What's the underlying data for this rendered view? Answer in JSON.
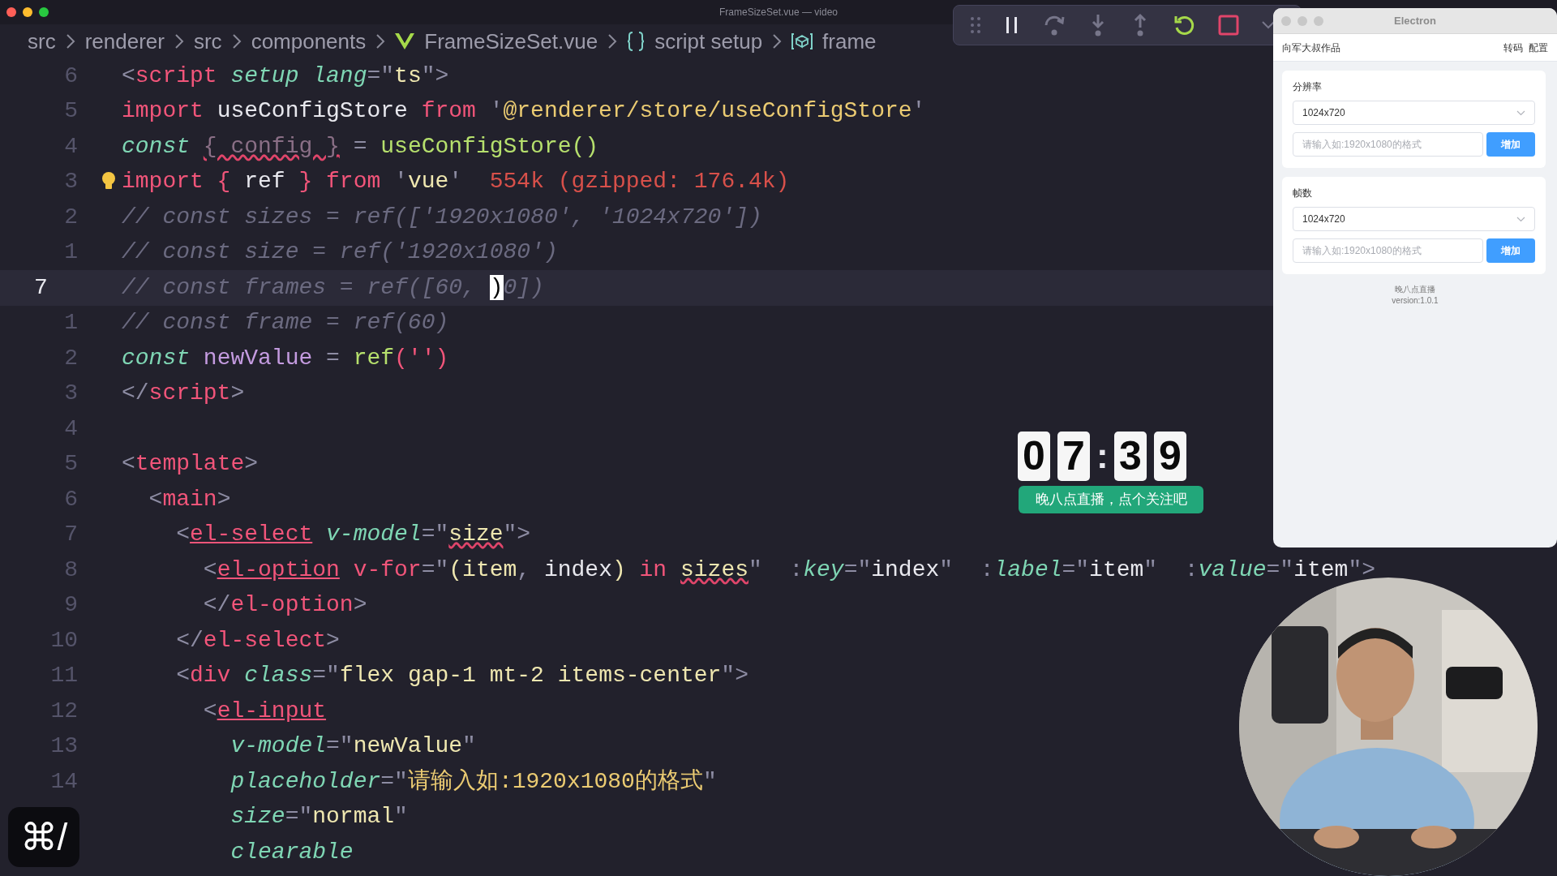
{
  "window": {
    "title": "FrameSizeSet.vue — video"
  },
  "breadcrumb": [
    {
      "kind": "folder",
      "text": "src"
    },
    {
      "kind": "folder",
      "text": "renderer"
    },
    {
      "kind": "folder",
      "text": "src"
    },
    {
      "kind": "folder",
      "text": "components"
    },
    {
      "kind": "vue-file",
      "text": "FrameSizeSet.vue"
    },
    {
      "kind": "braces",
      "text": "script setup"
    },
    {
      "kind": "symbol",
      "text": "frame"
    }
  ],
  "editor": {
    "lines": [
      {
        "number": "6",
        "selected": false,
        "lightbulb": false,
        "tokens": [
          {
            "kind": "punct",
            "text": "<"
          },
          {
            "kind": "tag",
            "text": "script"
          },
          {
            "kind": "attr",
            "text": " setup lang"
          },
          {
            "kind": "punct",
            "text": "=\""
          },
          {
            "kind": "string",
            "text": "ts"
          },
          {
            "kind": "punct",
            "text": "\">"
          }
        ]
      },
      {
        "number": "5",
        "selected": false,
        "lightbulb": false,
        "tokens": [
          {
            "kind": "keyword",
            "text": "import"
          },
          {
            "kind": "plain",
            "text": " useConfigStore "
          },
          {
            "kind": "keyword",
            "text": "from"
          },
          {
            "kind": "punct",
            "text": " '"
          },
          {
            "kind": "path",
            "text": "@renderer/store/useConfigStore"
          },
          {
            "kind": "punct",
            "text": "'"
          }
        ]
      },
      {
        "number": "4",
        "selected": false,
        "lightbulb": false,
        "tokens": [
          {
            "kind": "storage",
            "text": "const "
          },
          {
            "kind": "unused-error",
            "text": "{ config }"
          },
          {
            "kind": "punct",
            "text": " = "
          },
          {
            "kind": "fn",
            "text": "useConfigStore()"
          }
        ]
      },
      {
        "number": "3",
        "selected": false,
        "lightbulb": true,
        "tokens": [
          {
            "kind": "keyword",
            "text": "import { "
          },
          {
            "kind": "plain",
            "text": "ref"
          },
          {
            "kind": "keyword",
            "text": " } from "
          },
          {
            "kind": "punct",
            "text": "'"
          },
          {
            "kind": "string",
            "text": "vue"
          },
          {
            "kind": "punct",
            "text": "'"
          },
          {
            "kind": "hint",
            "text": "  554k (gzipped: 176.4k)"
          }
        ]
      },
      {
        "number": "2",
        "selected": false,
        "lightbulb": false,
        "tokens": [
          {
            "kind": "comment",
            "text": "// const sizes = ref(['1920x1080', '1024x720'])"
          }
        ]
      },
      {
        "number": "1",
        "selected": false,
        "lightbulb": false,
        "tokens": [
          {
            "kind": "comment",
            "text": "// const size = ref('1920x1080')"
          }
        ]
      },
      {
        "number": "7",
        "selected": true,
        "lightbulb": false,
        "tokens": [
          {
            "kind": "comment",
            "text": "// const frames = ref([60, "
          },
          {
            "kind": "cursor",
            "text": ")"
          },
          {
            "kind": "comment",
            "text": "0])"
          }
        ]
      },
      {
        "number": "1",
        "selected": false,
        "lightbulb": false,
        "tokens": [
          {
            "kind": "comment",
            "text": "// const frame = ref(60)"
          }
        ]
      },
      {
        "number": "2",
        "selected": false,
        "lightbulb": false,
        "tokens": [
          {
            "kind": "storage",
            "text": "const "
          },
          {
            "kind": "variable",
            "text": "newValue"
          },
          {
            "kind": "punct",
            "text": " = "
          },
          {
            "kind": "fn",
            "text": "ref"
          },
          {
            "kind": "keyword",
            "text": "('')"
          }
        ]
      },
      {
        "number": "3",
        "selected": false,
        "lightbulb": false,
        "tokens": [
          {
            "kind": "punct",
            "text": "</"
          },
          {
            "kind": "tag",
            "text": "script"
          },
          {
            "kind": "punct",
            "text": ">"
          }
        ]
      },
      {
        "number": "4",
        "selected": false,
        "lightbulb": false
      },
      {
        "number": "5",
        "selected": false,
        "lightbulb": false,
        "tokens": [
          {
            "kind": "punct",
            "text": "<"
          },
          {
            "kind": "tag",
            "text": "template"
          },
          {
            "kind": "punct",
            "text": ">"
          }
        ]
      },
      {
        "number": "6",
        "selected": false,
        "lightbulb": false,
        "tokens": [
          {
            "kind": "punct",
            "text": "  <"
          },
          {
            "kind": "tag",
            "text": "main"
          },
          {
            "kind": "punct",
            "text": ">"
          }
        ]
      },
      {
        "number": "7",
        "selected": false,
        "lightbulb": false,
        "tokens": [
          {
            "kind": "punct",
            "text": "    <"
          },
          {
            "kind": "component",
            "text": "el-select"
          },
          {
            "kind": "attr",
            "text": " v-model"
          },
          {
            "kind": "punct",
            "text": "=\""
          },
          {
            "kind": "string-error",
            "text": "size"
          },
          {
            "kind": "punct",
            "text": "\">"
          }
        ]
      },
      {
        "number": "8",
        "selected": false,
        "lightbulb": false,
        "tokens": [
          {
            "kind": "punct",
            "text": "      <"
          },
          {
            "kind": "component",
            "text": "el-option"
          },
          {
            "kind": "directive",
            "text": " v-for"
          },
          {
            "kind": "punct",
            "text": "=\""
          },
          {
            "kind": "string",
            "text": "(item"
          },
          {
            "kind": "punct",
            "text": ", "
          },
          {
            "kind": "plain",
            "text": "index"
          },
          {
            "kind": "string",
            "text": ")"
          },
          {
            "kind": "keyword",
            "text": " in "
          },
          {
            "kind": "string-error",
            "text": "sizes"
          },
          {
            "kind": "punct",
            "text": "\"  :"
          },
          {
            "kind": "attr",
            "text": "key"
          },
          {
            "kind": "punct",
            "text": "=\""
          },
          {
            "kind": "plain",
            "text": "index"
          },
          {
            "kind": "punct",
            "text": "\"  :"
          },
          {
            "kind": "attr",
            "text": "label"
          },
          {
            "kind": "punct",
            "text": "=\""
          },
          {
            "kind": "plain",
            "text": "item"
          },
          {
            "kind": "punct",
            "text": "\"  :"
          },
          {
            "kind": "attr",
            "text": "value"
          },
          {
            "kind": "punct",
            "text": "=\""
          },
          {
            "kind": "plain",
            "text": "item"
          },
          {
            "kind": "punct",
            "text": "\">"
          }
        ]
      },
      {
        "number": "9",
        "selected": false,
        "lightbulb": false,
        "tokens": [
          {
            "kind": "punct",
            "text": "      </"
          },
          {
            "kind": "tag",
            "text": "el-option"
          },
          {
            "kind": "punct",
            "text": ">"
          }
        ]
      },
      {
        "number": "10",
        "selected": false,
        "lightbulb": false,
        "tokens": [
          {
            "kind": "punct",
            "text": "    </"
          },
          {
            "kind": "tag",
            "text": "el-select"
          },
          {
            "kind": "punct",
            "text": ">"
          }
        ]
      },
      {
        "number": "11",
        "selected": false,
        "lightbulb": false,
        "tokens": [
          {
            "kind": "punct",
            "text": "    <"
          },
          {
            "kind": "tag",
            "text": "div"
          },
          {
            "kind": "attr",
            "text": " class"
          },
          {
            "kind": "punct",
            "text": "=\""
          },
          {
            "kind": "string",
            "text": "flex gap-1 mt-2 items-center"
          },
          {
            "kind": "punct",
            "text": "\">"
          }
        ]
      },
      {
        "number": "12",
        "selected": false,
        "lightbulb": false,
        "tokens": [
          {
            "kind": "punct",
            "text": "      <"
          },
          {
            "kind": "component",
            "text": "el-input"
          }
        ]
      },
      {
        "number": "13",
        "selected": false,
        "lightbulb": false,
        "tokens": [
          {
            "kind": "attr",
            "text": "        v-model"
          },
          {
            "kind": "punct",
            "text": "=\""
          },
          {
            "kind": "string",
            "text": "newValue"
          },
          {
            "kind": "punct",
            "text": "\""
          }
        ]
      },
      {
        "number": "14",
        "selected": false,
        "lightbulb": false,
        "tokens": [
          {
            "kind": "attr",
            "text": "        placeholder"
          },
          {
            "kind": "punct",
            "text": "=\""
          },
          {
            "kind": "path",
            "text": "请输入如:1920x1080的格式"
          },
          {
            "kind": "punct",
            "text": "\""
          }
        ]
      },
      {
        "selected": false,
        "lightbulb": false,
        "tokens": [
          {
            "kind": "attr",
            "text": "        size"
          },
          {
            "kind": "punct",
            "text": "=\""
          },
          {
            "kind": "string",
            "text": "normal"
          },
          {
            "kind": "punct",
            "text": "\""
          }
        ]
      },
      {
        "selected": false,
        "lightbulb": false,
        "tokens": [
          {
            "kind": "attr",
            "text": "        clearable"
          }
        ]
      }
    ]
  },
  "electron_window": {
    "title": "Electron",
    "brand": "向军大叔作品",
    "nav": [
      {
        "label": "转码"
      },
      {
        "label": "配置"
      }
    ],
    "sections": [
      {
        "label": "分辨率",
        "select_value": "1024x720",
        "placeholder": "请输入如:1920x1080的格式",
        "button": "增加"
      },
      {
        "label": "帧数",
        "select_value": "1024x720",
        "placeholder": "请输入如:1920x1080的格式",
        "button": "增加"
      }
    ],
    "footer": [
      "晚八点直播",
      "version:1.0.1"
    ]
  },
  "timer": {
    "minute_digits": [
      "0",
      "7"
    ],
    "separator": ":",
    "second_digits": [
      "3",
      "9"
    ],
    "banner": "晚八点直播，点个关注吧"
  },
  "shortcut_overlay": {
    "keys": "⌘/"
  }
}
